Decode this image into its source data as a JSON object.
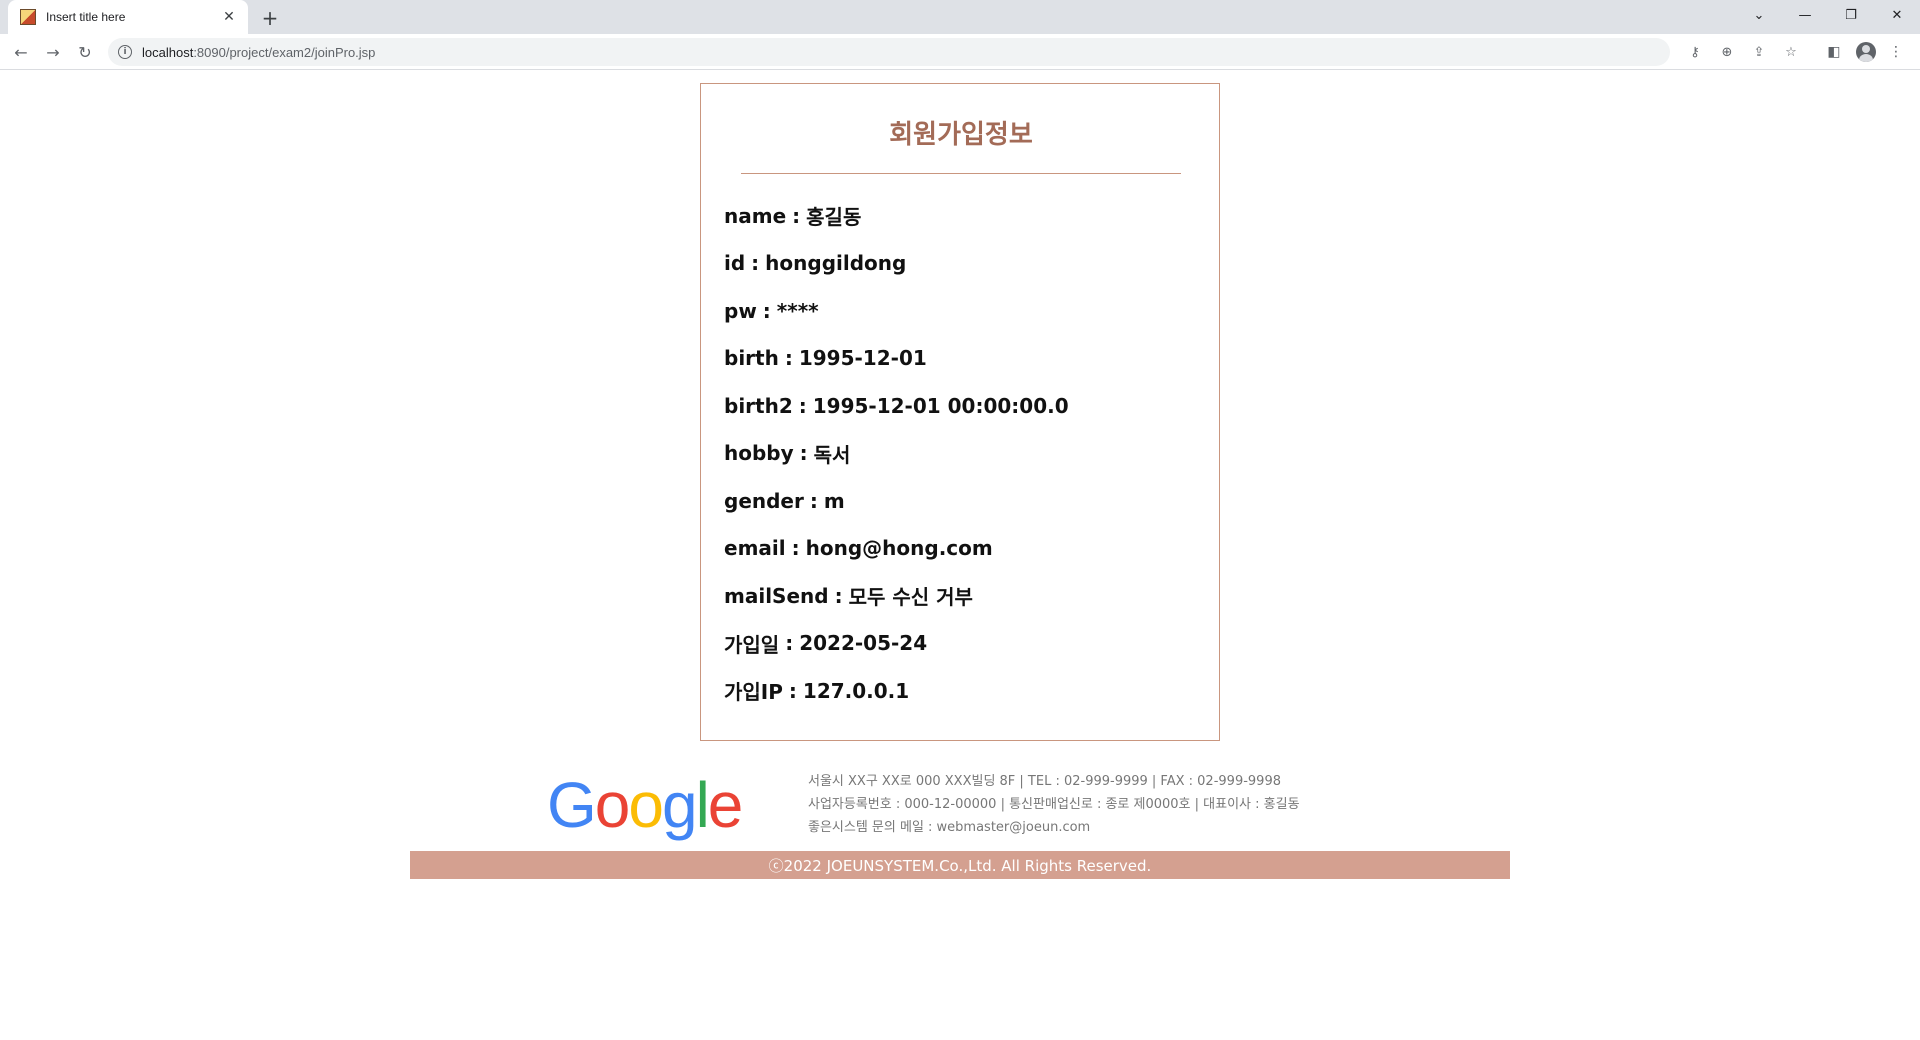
{
  "browser": {
    "tab_title": "Insert title here",
    "url_host": "localhost",
    "url_path": ":8090/project/exam2/joinPro.jsp",
    "icons": [
      "back-arrow-icon",
      "forward-arrow-icon",
      "reload-icon",
      "info-icon",
      "key-icon",
      "zoom-icon",
      "share-icon",
      "star-icon",
      "sidebar-icon",
      "profile-icon",
      "menu-icon"
    ]
  },
  "card": {
    "title": "회원가입정보",
    "rows": [
      {
        "label": "name",
        "value": "홍길동"
      },
      {
        "label": "id",
        "value": "honggildong"
      },
      {
        "label": "pw",
        "value": "****"
      },
      {
        "label": "birth",
        "value": "1995-12-01"
      },
      {
        "label": "birth2",
        "value": "1995-12-01 00:00:00.0"
      },
      {
        "label": "hobby",
        "value": "독서"
      },
      {
        "label": "gender",
        "value": "m"
      },
      {
        "label": "email",
        "value": "hong@hong.com"
      },
      {
        "label": "mailSend",
        "value": "모두 수신 거부"
      },
      {
        "label": "가입일",
        "value": "2022-05-24"
      },
      {
        "label": "가입IP",
        "value": "127.0.0.1"
      }
    ]
  },
  "footer": {
    "logo_text": "Google",
    "line1": "서울시 XX구 XX로 000 XXX빌딩 8F | TEL : 02-999-9999 | FAX : 02-999-9998",
    "line2": "사업자등록번호 : 000-12-00000 | 통신판매업신로 : 종로 제0000호 | 대표이사 : 홍길동",
    "line3": "좋은시스템 문의 메일 : webmaster@joeun.com",
    "copyright": "ⓒ2022 JOEUNSYSTEM.Co.,Ltd. All Rights Reserved."
  },
  "colors": {
    "accent": "#a36b57",
    "border": "#c9967f",
    "copyright_bar": "#d4a090"
  }
}
